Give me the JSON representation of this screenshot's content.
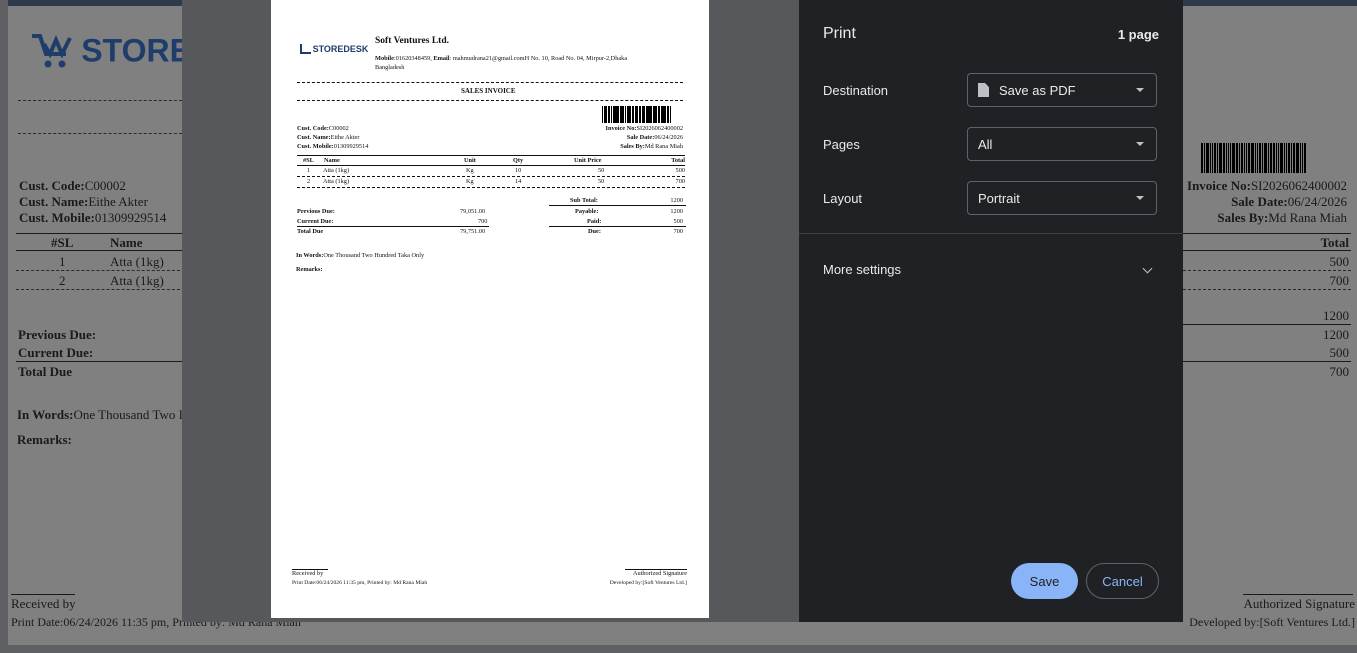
{
  "background_page": {
    "logo_text": "STORE",
    "cust_code_label": "Cust. Code:",
    "cust_code": "C00002",
    "cust_name_label": "Cust. Name:",
    "cust_name": "Eithe Akter",
    "cust_mobile_label": "Cust. Mobile:",
    "cust_mobile": "01309929514",
    "col_sl": "#SL",
    "col_name": "Name",
    "col_total": "Total",
    "rows": [
      {
        "sl": "1",
        "name": "Atta (1kg)",
        "total": "500"
      },
      {
        "sl": "2",
        "name": "Atta (1kg)",
        "total": "700"
      }
    ],
    "invoice_no_label": "Invoice No:",
    "invoice_no": "SI2026062400002",
    "sale_date_label": "Sale Date:",
    "sale_date": "06/24/2026",
    "sales_by_label": "Sales By:",
    "sales_by": "Md Rana Miah",
    "previous_due_label": "Previous Due:",
    "current_due_label": "Current Due:",
    "total_due_label": "Total Due",
    "right_values": [
      "1200",
      "1200",
      "500",
      "700"
    ],
    "in_words_label": "In Words:",
    "in_words": "One Thousand Two I",
    "remarks_label": "Remarks:",
    "received_by": "Received by",
    "print_date": "Print Date:06/24/2026 11:35 pm, Printed by: Md Rana Miah",
    "authorized_signature": "Authorized Signature",
    "developed_by": "Developed by:[Soft Ventures Ltd.]"
  },
  "preview": {
    "company": "Soft Ventures Ltd.",
    "logo_text": "STOREDESK",
    "mobile_label": "Mobile",
    "mobile": ":01620348459,",
    "email_label": "Email",
    "email": ": mahmudrana21@gmail.comH No. 10, Road No. 04, Mirpur-2,Dhaka",
    "address2": "Bangladesh",
    "title": "SALES INVOICE",
    "cust_code_label": "Cust. Code:",
    "cust_code": "C00002",
    "cust_name_label": "Cust. Name:",
    "cust_name": "Eithe Akter",
    "cust_mobile_label": "Cust. Mobile:",
    "cust_mobile": "01309929514",
    "invoice_no_label": "Invoice No:",
    "invoice_no": "SI2026062400002",
    "sale_date_label": "Sale Date:",
    "sale_date": "06/24/2026",
    "sales_by_label": "Sales By:",
    "sales_by": "Md Rana Miah",
    "headers": {
      "sl": "#SL",
      "name": "Name",
      "unit": "Unit",
      "qty": "Qty",
      "price": "Unit Price",
      "total": "Total"
    },
    "rows": [
      {
        "sl": "1",
        "name": "Atta (1kg)",
        "unit": "Kg",
        "qty": "10",
        "price": "50",
        "total": "500"
      },
      {
        "sl": "2",
        "name": "Atta (1kg)",
        "unit": "Kg",
        "qty": "14",
        "price": "50",
        "total": "700"
      }
    ],
    "sub_total_label": "Sub Total:",
    "sub_total": "1200",
    "payable_label": "Payable:",
    "payable": "1200",
    "paid_label": "Paid:",
    "paid": "500",
    "due_label": "Due:",
    "due": "700",
    "previous_due_label": "Previous Due:",
    "previous_due": "79,051.00",
    "current_due_label": "Current Due:",
    "current_due": "700",
    "total_due_label": "Total Due",
    "total_due": "79,751.00",
    "in_words_label": "In Words:",
    "in_words": "One Thousand Two Hundred Taka Only",
    "remarks_label": "Remarks:",
    "received_by": "Received by",
    "print_date": "Print Date:06/24/2026 11:35 pm, Printed by: Md Rana Miah",
    "authorized_signature": "Authorized Signature",
    "developed_by": "Developed by:[Soft Ventures Ltd.]"
  },
  "print_panel": {
    "title": "Print",
    "page_count": "1 page",
    "destination_label": "Destination",
    "destination_value": "Save as PDF",
    "pages_label": "Pages",
    "pages_value": "All",
    "layout_label": "Layout",
    "layout_value": "Portrait",
    "more_settings": "More settings",
    "save": "Save",
    "cancel": "Cancel",
    "accent": "#8ab4f8"
  }
}
